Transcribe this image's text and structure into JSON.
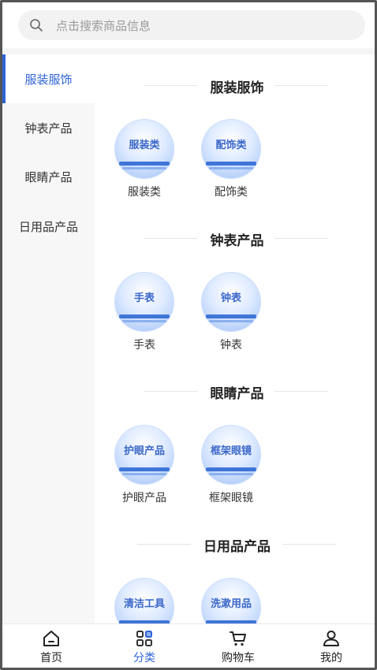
{
  "search": {
    "placeholder": "点击搜索商品信息"
  },
  "sidebar": {
    "items": [
      {
        "label": "服装服饰",
        "active": true
      },
      {
        "label": "钟表产品",
        "active": false
      },
      {
        "label": "眼睛产品",
        "active": false
      },
      {
        "label": "日用品产品",
        "active": false
      }
    ]
  },
  "sections": [
    {
      "title": "服装服饰",
      "items": [
        {
          "label": "服装类",
          "image_text": "服装类"
        },
        {
          "label": "配饰类",
          "image_text": "配饰类"
        }
      ]
    },
    {
      "title": "钟表产品",
      "items": [
        {
          "label": "手表",
          "image_text": "手表"
        },
        {
          "label": "钟表",
          "image_text": "钟表"
        }
      ]
    },
    {
      "title": "眼睛产品",
      "items": [
        {
          "label": "护眼产品",
          "image_text": "护眼产品"
        },
        {
          "label": "框架眼镜",
          "image_text": "框架眼镜"
        }
      ]
    },
    {
      "title": "日用品产品",
      "items": [
        {
          "label": "",
          "image_text": "清洁工具"
        },
        {
          "label": "",
          "image_text": "洗漱用品"
        }
      ]
    }
  ],
  "tabbar": {
    "items": [
      {
        "label": "首页",
        "icon": "home-icon",
        "active": false
      },
      {
        "label": "分类",
        "icon": "category-icon",
        "active": true
      },
      {
        "label": "购物车",
        "icon": "cart-icon",
        "active": false
      },
      {
        "label": "我的",
        "icon": "user-icon",
        "active": false
      }
    ]
  },
  "colors": {
    "accent": "#2f64d6",
    "sidebar_bg": "#f7f7f7",
    "search_bg": "#f2f2f2"
  }
}
